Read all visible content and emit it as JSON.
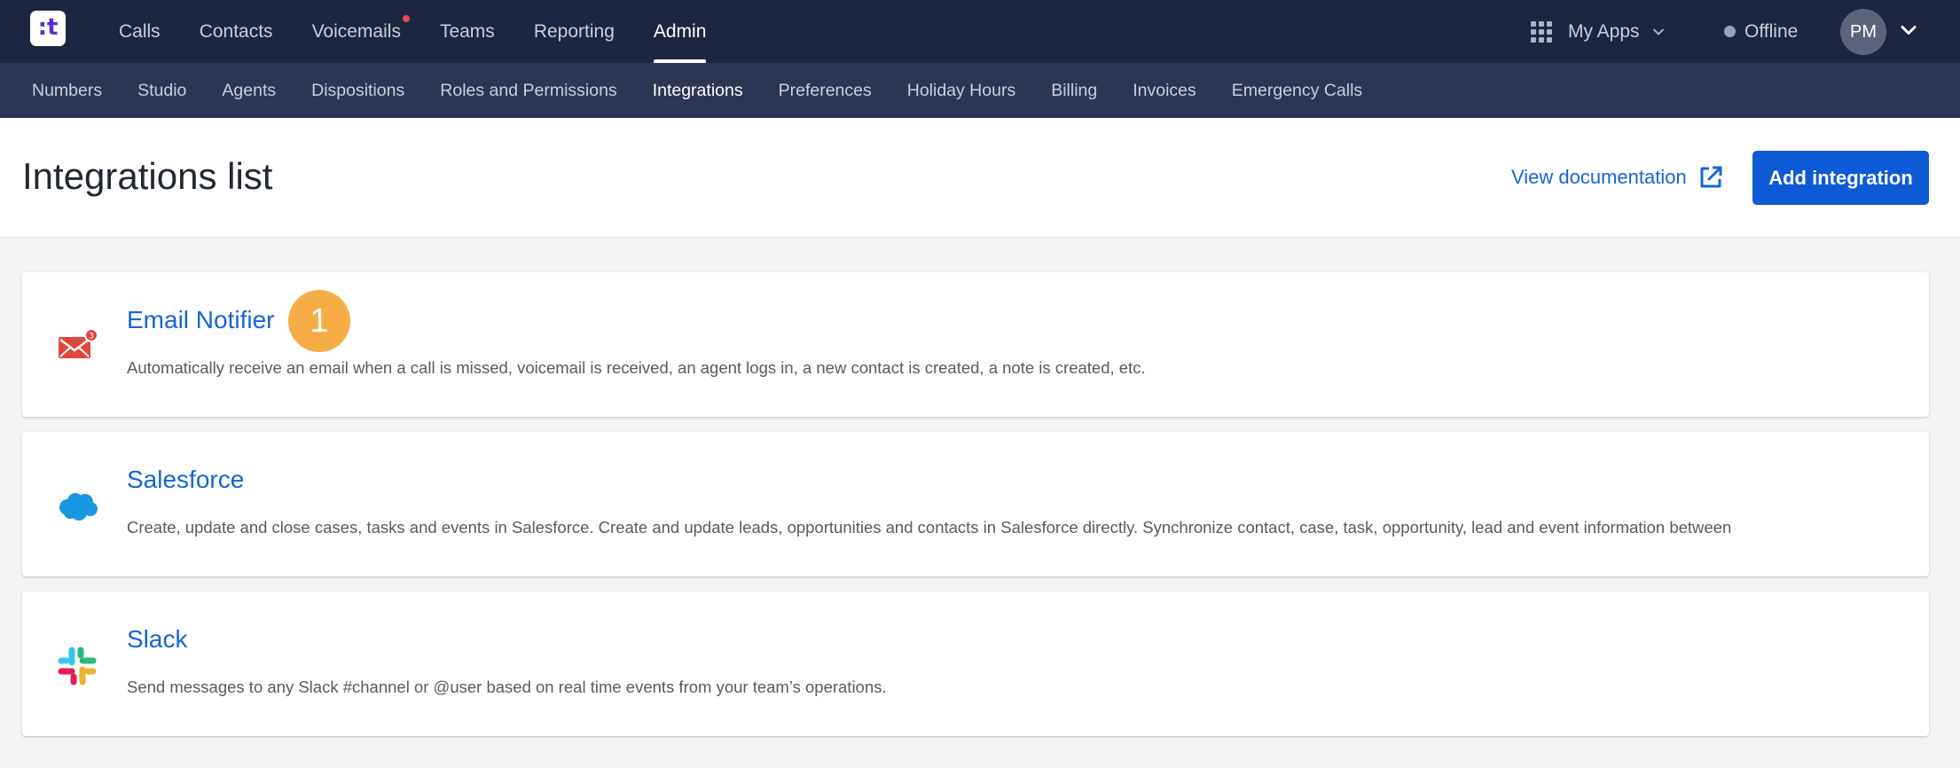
{
  "app": {
    "logo_text": ":t"
  },
  "topnav": {
    "items": [
      {
        "label": "Calls"
      },
      {
        "label": "Contacts"
      },
      {
        "label": "Voicemails"
      },
      {
        "label": "Teams"
      },
      {
        "label": "Reporting"
      },
      {
        "label": "Admin"
      }
    ],
    "active": "Admin",
    "my_apps": "My Apps",
    "status": "Offline",
    "avatar_initials": "PM"
  },
  "subnav": {
    "items": [
      {
        "label": "Numbers"
      },
      {
        "label": "Studio"
      },
      {
        "label": "Agents"
      },
      {
        "label": "Dispositions"
      },
      {
        "label": "Roles and Permissions"
      },
      {
        "label": "Integrations"
      },
      {
        "label": "Preferences"
      },
      {
        "label": "Holiday Hours"
      },
      {
        "label": "Billing"
      },
      {
        "label": "Invoices"
      },
      {
        "label": "Emergency Calls"
      }
    ],
    "active": "Integrations"
  },
  "header": {
    "title": "Integrations list",
    "view_docs": "View documentation",
    "add_button": "Add integration"
  },
  "integrations": [
    {
      "name": "Email Notifier",
      "icon": "envelope-icon",
      "description": "Automatically receive an email when a call is missed, voicemail is received, an agent logs in, a new contact is created, a note is created, etc.",
      "badge": "1"
    },
    {
      "name": "Salesforce",
      "icon": "salesforce-cloud-icon",
      "description": "Create, update and close cases, tasks and events in Salesforce. Create and update leads, opportunities and contacts in Salesforce directly. Synchronize contact, case, task, opportunity, lead and event information between"
    },
    {
      "name": "Slack",
      "icon": "slack-icon",
      "description": "Send messages to any Slack #channel or @user based on real time events from your team’s operations."
    }
  ],
  "colors": {
    "topnav_bg": "#1c2640",
    "subnav_bg": "#2b3654",
    "link": "#1565d8",
    "primary_button": "#0e5ad6",
    "badge": "#f7ad45",
    "notification_dot": "#e5484d"
  }
}
